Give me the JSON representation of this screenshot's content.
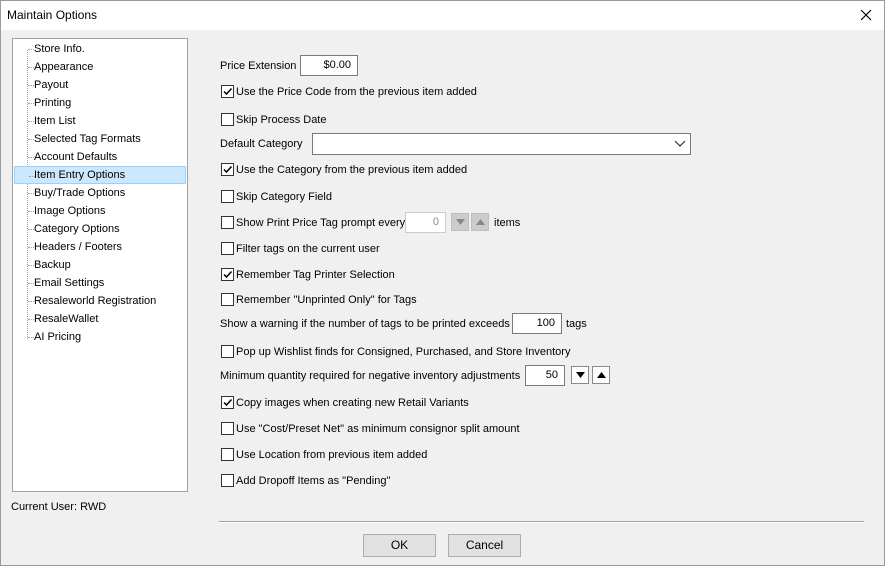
{
  "window": {
    "title": "Maintain Options"
  },
  "sidebar": {
    "items": [
      {
        "label": "Store Info."
      },
      {
        "label": "Appearance"
      },
      {
        "label": "Payout"
      },
      {
        "label": "Printing"
      },
      {
        "label": "Item List"
      },
      {
        "label": "Selected Tag Formats"
      },
      {
        "label": "Account Defaults"
      },
      {
        "label": "Item Entry Options",
        "selected": true
      },
      {
        "label": "Buy/Trade Options"
      },
      {
        "label": "Image Options"
      },
      {
        "label": "Category Options"
      },
      {
        "label": "Headers / Footers"
      },
      {
        "label": "Backup"
      },
      {
        "label": "Email Settings"
      },
      {
        "label": "Resaleworld Registration"
      },
      {
        "label": "ResaleWallet"
      },
      {
        "label": "AI Pricing"
      }
    ]
  },
  "status": {
    "current_user": "Current User: RWD"
  },
  "options": {
    "price_extension_label": "Price Extension",
    "price_extension_value": "$0.00",
    "use_price_code": {
      "label": "Use the Price Code from the previous item added",
      "checked": true
    },
    "skip_process_date": {
      "label": "Skip Process Date",
      "checked": false
    },
    "default_category_label": "Default Category",
    "default_category_value": "",
    "use_category": {
      "label": "Use the Category from the previous item added",
      "checked": true
    },
    "skip_category_field": {
      "label": "Skip Category Field",
      "checked": false
    },
    "show_print_price_tag": {
      "label": "Show Print Price Tag prompt every",
      "checked": false,
      "value": "0",
      "suffix": "items"
    },
    "filter_tags": {
      "label": "Filter tags on the current user",
      "checked": false
    },
    "remember_tag_printer": {
      "label": "Remember Tag Printer Selection",
      "checked": true
    },
    "remember_unprinted": {
      "label": "Remember \"Unprinted Only\" for Tags",
      "checked": false
    },
    "warning_tags_label": "Show a warning if the number of tags to be printed exceeds",
    "warning_tags_value": "100",
    "warning_tags_suffix": "tags",
    "popup_wishlist": {
      "label": "Pop up Wishlist finds for Consigned, Purchased, and Store Inventory",
      "checked": false
    },
    "min_qty_label": "Minimum quantity required for negative inventory adjustments",
    "min_qty_value": "50",
    "copy_images": {
      "label": "Copy images when creating new Retail Variants",
      "checked": true
    },
    "use_cost_preset": {
      "label": "Use \"Cost/Preset Net\" as minimum consignor split amount",
      "checked": false
    },
    "use_location": {
      "label": "Use Location from previous item added",
      "checked": false
    },
    "add_dropoff": {
      "label": "Add Dropoff Items as \"Pending\"",
      "checked": false
    }
  },
  "buttons": {
    "ok": "OK",
    "cancel": "Cancel"
  },
  "icons": {
    "close": "close-icon",
    "check": "checkmark-icon",
    "dropdown": "chevron-down-icon",
    "spin_down": "triangle-down-icon",
    "spin_up": "triangle-up-icon"
  }
}
